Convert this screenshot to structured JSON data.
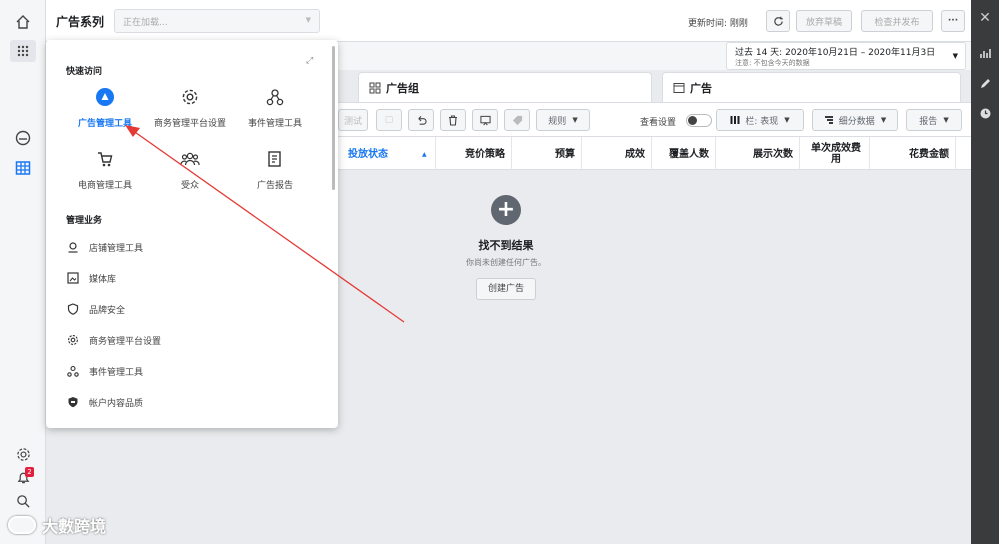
{
  "topbar": {
    "title": "广告系列",
    "dropdown_value": "正在加载...",
    "updated": "更新时间: 刚刚",
    "discard": "放弃草稿",
    "review": "检查并发布",
    "more": "···"
  },
  "date_range": {
    "main": "过去 14 天: 2020年10月21日 – 2020年11月3日",
    "note": "注意: 不包含今天的数据"
  },
  "tabs": {
    "adset": "广告组",
    "ad": "广告"
  },
  "toolbar": {
    "test": "测试",
    "rules": "规则",
    "view_settings": "查看设置",
    "columns": "栏: 表现",
    "breakdown": "细分数据",
    "reports": "报告"
  },
  "table_headers": [
    "投放状态",
    "竞价策略",
    "预算",
    "成效",
    "覆盖人数",
    "展示次数",
    "单次成效费用",
    "花费金额"
  ],
  "empty": {
    "title": "找不到结果",
    "subtitle": "你尚未创建任何广告。",
    "button": "创建广告"
  },
  "popup": {
    "quick_access_title": "快速访问",
    "quick_access": [
      {
        "label": "广告管理工具",
        "icon": "ads-manager-icon"
      },
      {
        "label": "商务管理平台设置",
        "icon": "gear-icon"
      },
      {
        "label": "事件管理工具",
        "icon": "events-icon"
      },
      {
        "label": "电商管理工具",
        "icon": "cart-icon"
      },
      {
        "label": "受众",
        "icon": "audience-icon"
      },
      {
        "label": "广告报告",
        "icon": "report-icon"
      }
    ],
    "manage_title": "管理业务",
    "manage": [
      {
        "label": "店铺管理工具",
        "icon": "store-icon"
      },
      {
        "label": "媒体库",
        "icon": "media-icon"
      },
      {
        "label": "品牌安全",
        "icon": "shield-icon"
      },
      {
        "label": "商务管理平台设置",
        "icon": "gear-icon"
      },
      {
        "label": "事件管理工具",
        "icon": "events-icon"
      },
      {
        "label": "帐户内容品质",
        "icon": "quality-icon"
      }
    ]
  },
  "notifications_badge": "2",
  "watermark": "大數跨境",
  "colors": {
    "accent": "#1877f2",
    "arrow": "#e53935"
  }
}
